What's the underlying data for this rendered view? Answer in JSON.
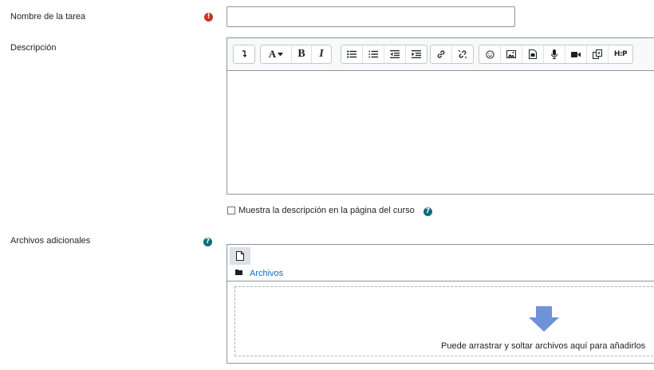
{
  "form": {
    "name_label": "Nombre de la tarea",
    "name_value": "",
    "required_icon": "exclamation-icon",
    "description_label": "Descripción",
    "show_description_label": "Muestra la descripción en la página del curso",
    "show_description_checked": false,
    "additional_files_label": "Archivos adicionales"
  },
  "toolbar": {
    "font_label": "A",
    "bold_label": "B",
    "italic_label": "I",
    "h5p_label": "H:P"
  },
  "filepicker": {
    "path_label": "Archivos",
    "drop_text": "Puede arrastrar y soltar archivos aquí para añadirlos"
  },
  "colors": {
    "required": "#ca3120",
    "help": "#0f6c7e",
    "link": "#0f6cbf",
    "drop_arrow": "#6e93d8"
  }
}
